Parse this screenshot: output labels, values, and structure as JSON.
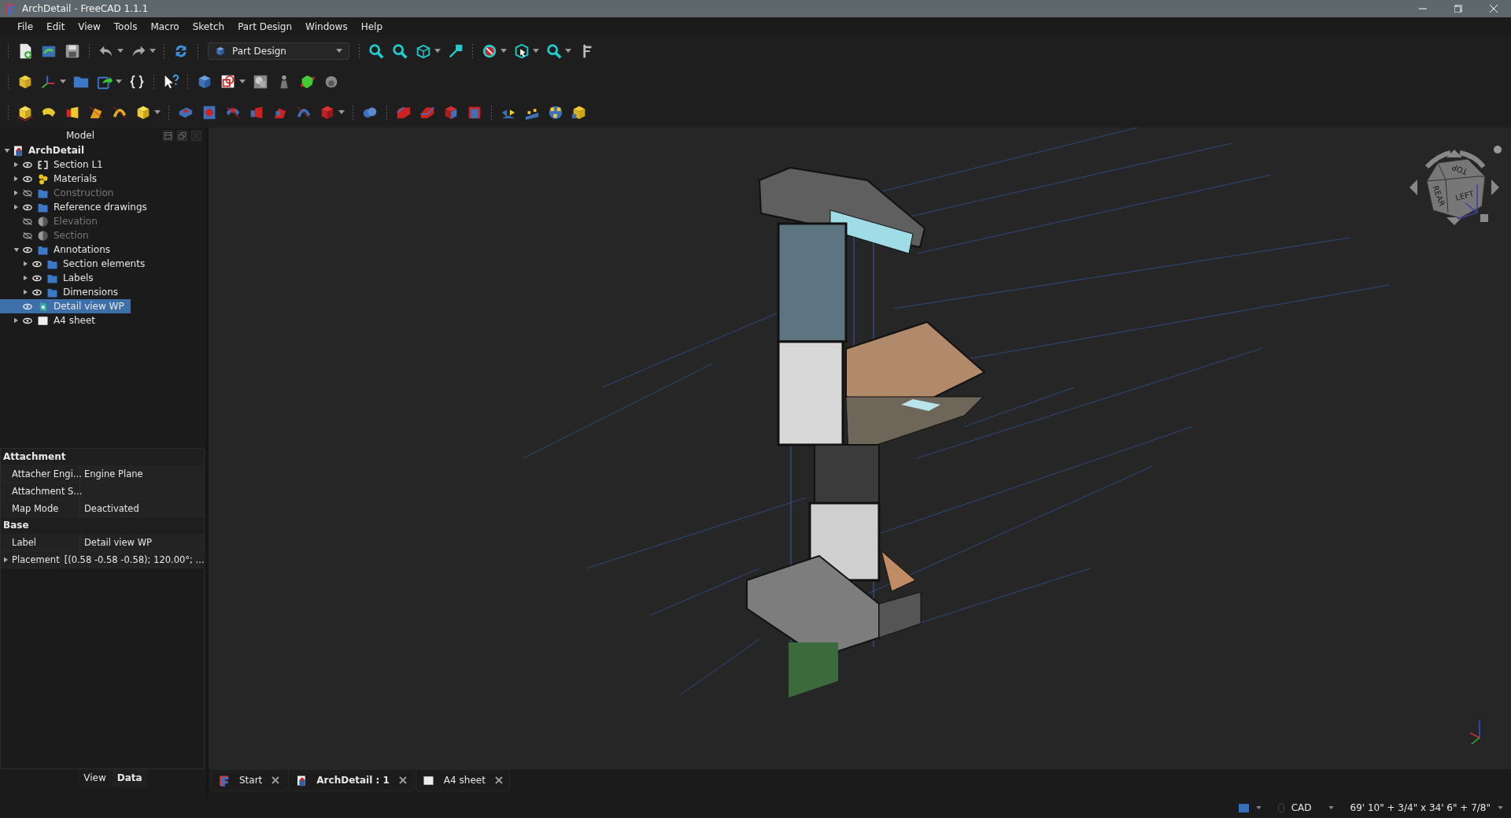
{
  "window": {
    "title": "ArchDetail - FreeCAD 1.1.1"
  },
  "menu": [
    "File",
    "Edit",
    "View",
    "Tools",
    "Macro",
    "Sketch",
    "Part Design",
    "Windows",
    "Help"
  ],
  "workbench": {
    "value": "Part Design"
  },
  "tree": {
    "title": "Model",
    "items": [
      {
        "label": "ArchDetail",
        "kind": "document",
        "expanded": true,
        "selected": false,
        "children": [
          {
            "label": "Section L1",
            "kind": "section",
            "expanded": false,
            "visible": true,
            "selected": false
          },
          {
            "label": "Materials",
            "kind": "materials",
            "expanded": false,
            "visible": true,
            "selected": false
          },
          {
            "label": "Construction",
            "kind": "folder",
            "expanded": false,
            "visible": false,
            "selected": false
          },
          {
            "label": "Reference drawings",
            "kind": "folder",
            "expanded": false,
            "visible": true,
            "selected": false
          },
          {
            "label": "Elevation",
            "kind": "view",
            "visible": false,
            "selected": false
          },
          {
            "label": "Section",
            "kind": "view",
            "visible": false,
            "selected": false
          },
          {
            "label": "Annotations",
            "kind": "folder",
            "expanded": true,
            "visible": true,
            "selected": false,
            "children": [
              {
                "label": "Section elements",
                "kind": "folder",
                "expanded": false,
                "visible": true,
                "selected": false
              },
              {
                "label": "Labels",
                "kind": "folder",
                "expanded": false,
                "visible": true,
                "selected": false
              },
              {
                "label": "Dimensions",
                "kind": "folder",
                "expanded": false,
                "visible": true,
                "selected": false
              }
            ]
          },
          {
            "label": "Detail view WP",
            "kind": "workplane",
            "visible": true,
            "selected": true
          },
          {
            "label": "A4 sheet",
            "kind": "sheet",
            "expanded": false,
            "visible": true,
            "selected": false
          }
        ]
      }
    ]
  },
  "properties": [
    {
      "group": "Attachment",
      "rows": [
        {
          "name": "Attacher Engi...",
          "value": "Engine Plane"
        },
        {
          "name": "Attachment S..."
        },
        {
          "name": "Map Mode",
          "value": "Deactivated"
        }
      ]
    },
    {
      "group": "Base",
      "rows": [
        {
          "name": "Label",
          "value": "Detail view WP"
        },
        {
          "name": "Placement",
          "value": "[(0.58 -0.58 -0.58); 120.00°; ...",
          "expanded": false
        }
      ]
    }
  ],
  "panel_tabs": [
    {
      "label": "View",
      "selected": false
    },
    {
      "label": "Data",
      "selected": true
    }
  ],
  "nav_cube": {
    "faces": [
      "TOP",
      "REAR",
      "LEFT"
    ]
  },
  "doc_tabs": [
    {
      "label": "Start",
      "kind": "freecad",
      "selected": false
    },
    {
      "label": "ArchDetail : 1",
      "kind": "document",
      "selected": true
    },
    {
      "label": "A4 sheet",
      "kind": "sheet",
      "selected": false
    }
  ],
  "status_bar": {
    "navigation_style": "CAD",
    "dimensions": "69' 10\" + 3/4\" x 34' 6\" + 7/8\""
  }
}
